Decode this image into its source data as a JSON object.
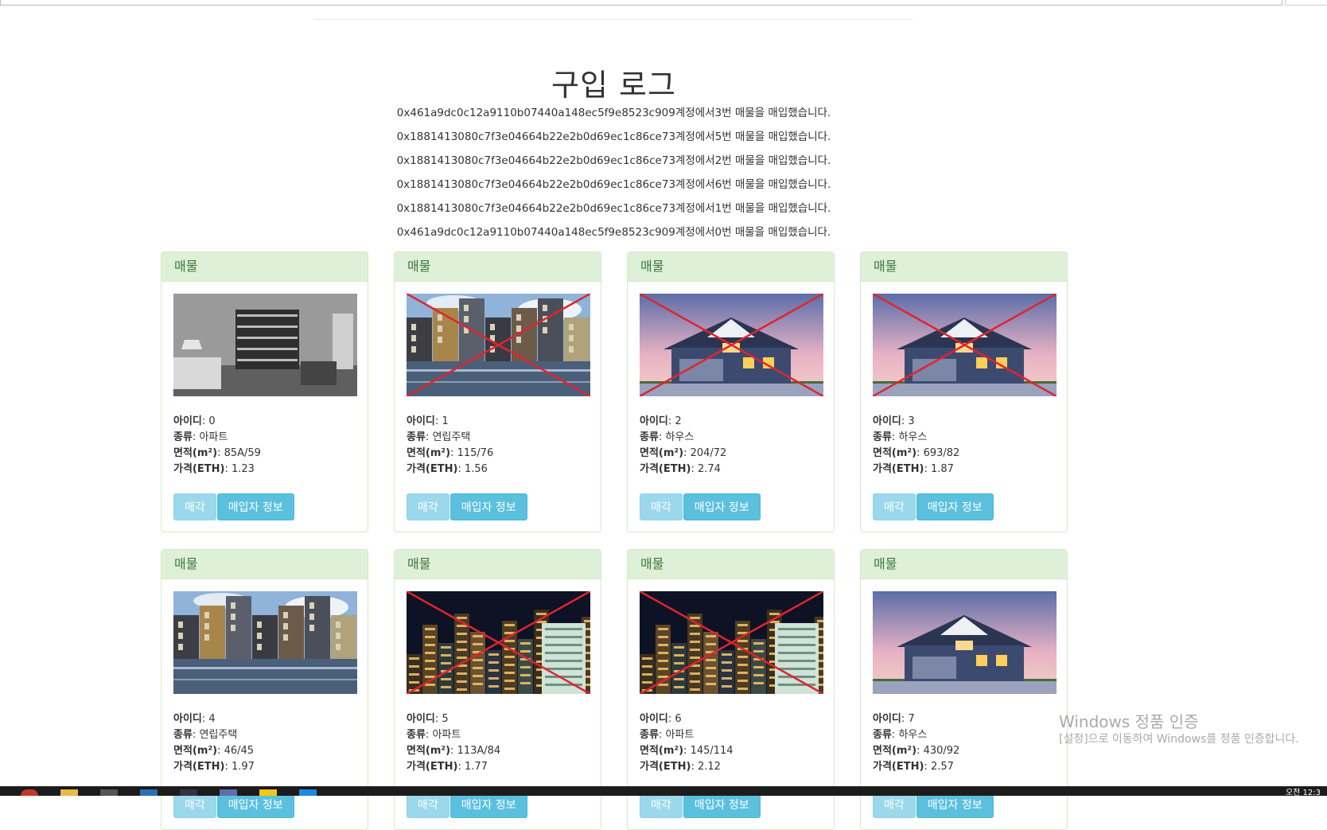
{
  "page": {
    "title": "구입 로그"
  },
  "logs": [
    "0x461a9dc0c12a9110b07440a148ec5f9e8523c909계정에서3번 매물을 매입했습니다.",
    "0x1881413080c7f3e04664b22e2b0d69ec1c86ce73계정에서5번 매물을 매입했습니다.",
    "0x1881413080c7f3e04664b22e2b0d69ec1c86ce73계정에서2번 매물을 매입했습니다.",
    "0x1881413080c7f3e04664b22e2b0d69ec1c86ce73계정에서6번 매물을 매입했습니다.",
    "0x1881413080c7f3e04664b22e2b0d69ec1c86ce73계정에서1번 매물을 매입했습니다.",
    "0x461a9dc0c12a9110b07440a148ec5f9e8523c909계정에서0번 매물을 매입했습니다."
  ],
  "labels": {
    "card_header": "매물",
    "id": "아이디",
    "type": "종류",
    "area": "면적(m²)",
    "price": "가격(ETH)",
    "sell_button": "매각",
    "buyer_button": "매입자 정보"
  },
  "properties": [
    {
      "id": "0",
      "type": "아파트",
      "area": "85A/59",
      "price": "1.23",
      "image": "interior-bw",
      "sold": false
    },
    {
      "id": "1",
      "type": "연립주택",
      "area": "115/76",
      "price": "1.56",
      "image": "canal-houses",
      "sold": true
    },
    {
      "id": "2",
      "type": "하우스",
      "area": "204/72",
      "price": "2.74",
      "image": "suburban-house",
      "sold": true
    },
    {
      "id": "3",
      "type": "하우스",
      "area": "693/82",
      "price": "1.87",
      "image": "suburban-house",
      "sold": true
    },
    {
      "id": "4",
      "type": "연립주택",
      "area": "46/45",
      "price": "1.97",
      "image": "canal-houses",
      "sold": false
    },
    {
      "id": "5",
      "type": "아파트",
      "area": "113A/84",
      "price": "1.77",
      "image": "night-city",
      "sold": true
    },
    {
      "id": "6",
      "type": "아파트",
      "area": "145/114",
      "price": "2.12",
      "image": "night-city",
      "sold": true
    },
    {
      "id": "7",
      "type": "하우스",
      "area": "430/92",
      "price": "2.57",
      "image": "suburban-house",
      "sold": false
    }
  ],
  "watermark": {
    "line1": "Windows 정품 인증",
    "line2": "[설정]으로 이동하여 Windows를 정품 인증합니다."
  },
  "taskbar": {
    "clock": "오전 12:3"
  },
  "colors": {
    "panel_heading_bg": "#dff0d8",
    "panel_border": "#d6e9c6",
    "panel_heading_text": "#3c763d",
    "button_info": "#5bc0de",
    "sold_cross": "#e0242e"
  }
}
